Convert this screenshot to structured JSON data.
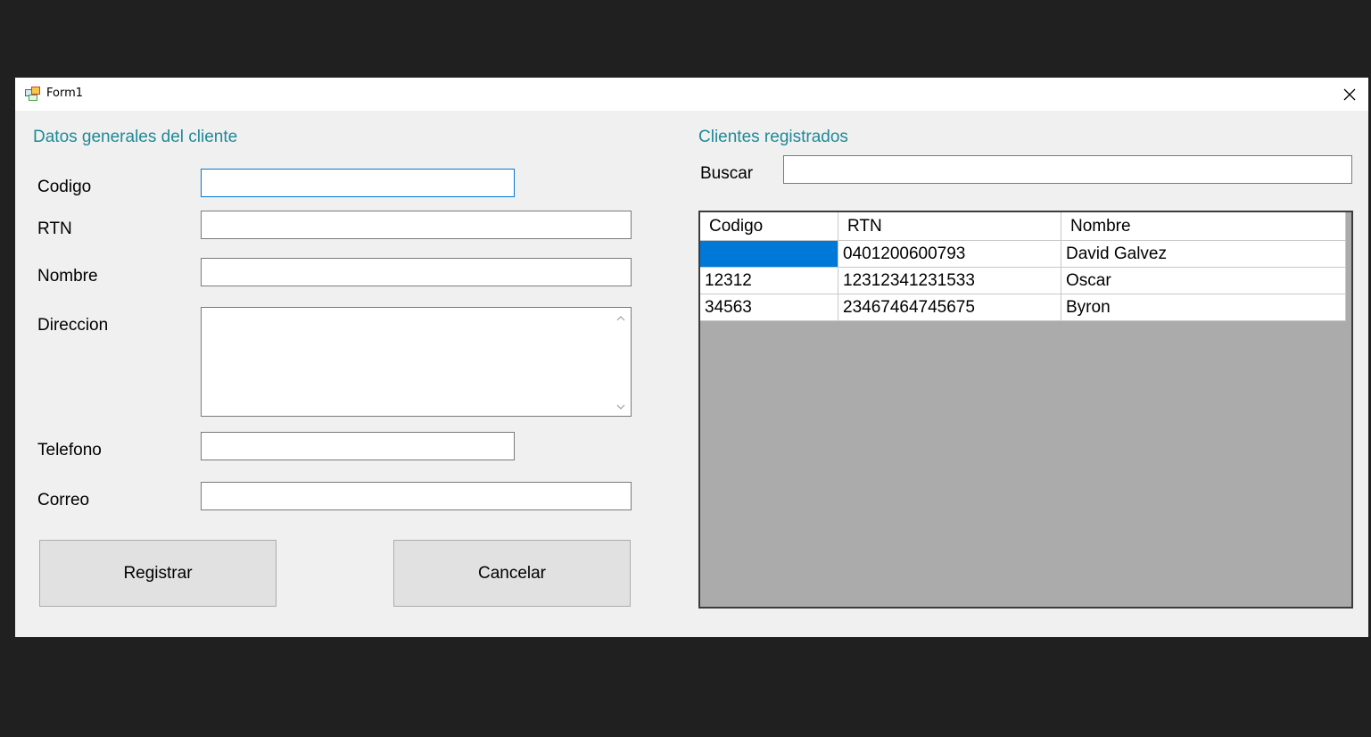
{
  "window": {
    "title": "Form1"
  },
  "form": {
    "section_title": "Datos generales del cliente",
    "fields": {
      "codigo": {
        "label": "Codigo",
        "value": ""
      },
      "rtn": {
        "label": "RTN",
        "value": ""
      },
      "nombre": {
        "label": "Nombre",
        "value": ""
      },
      "direccion": {
        "label": "Direccion",
        "value": ""
      },
      "telefono": {
        "label": "Telefono",
        "value": ""
      },
      "correo": {
        "label": "Correo",
        "value": ""
      }
    },
    "buttons": {
      "register": "Registrar",
      "cancel": "Cancelar"
    }
  },
  "clients": {
    "section_title": "Clientes registrados",
    "search_label": "Buscar",
    "search_value": "",
    "columns": [
      "Codigo",
      "RTN",
      "Nombre"
    ],
    "rows": [
      {
        "codigo": "",
        "rtn": "0401200600793",
        "nombre": "David Galvez",
        "selected": true
      },
      {
        "codigo": "12312",
        "rtn": "12312341231533",
        "nombre": "Oscar"
      },
      {
        "codigo": "34563",
        "rtn": "23467464745675",
        "nombre": "Byron"
      }
    ]
  },
  "colors": {
    "accent": "#1e8a98",
    "selection": "#0078d7",
    "grid_background": "#ababab"
  }
}
